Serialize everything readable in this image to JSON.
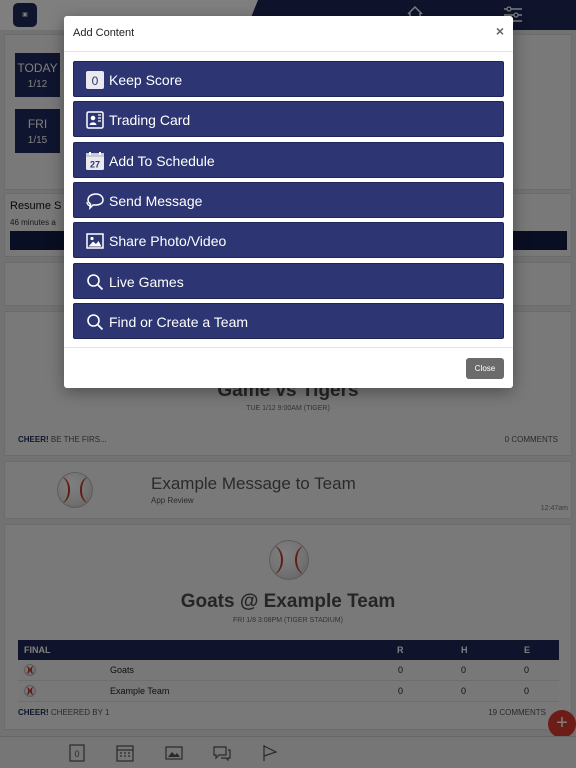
{
  "background": {
    "dates": [
      {
        "day": "TODAY",
        "date": "1/12"
      },
      {
        "day": "FRI",
        "date": "1/15"
      }
    ],
    "resume": {
      "title": "Resume S",
      "subtitle": "46 minutes a"
    },
    "game1": {
      "title": "Game vs Tigers",
      "subtitle": "TUE 1/12 9:00AM (TIGER)",
      "cheer_label": "CHEER!",
      "cheer_text": "BE THE FIRS...",
      "comments": "0 COMMENTS"
    },
    "message": {
      "title": "Example Message to Team",
      "subtitle": "App Review",
      "time": "12:47am"
    },
    "game2": {
      "title": "Goats @ Example Team",
      "subtitle": "FRI 1/8 3:08PM (TIGER STADIUM)",
      "cheer_label": "CHEER!",
      "cheer_text": "CHEERED BY 1",
      "comments": "19 COMMENTS",
      "table": {
        "headers": [
          "FINAL",
          "R",
          "H",
          "E"
        ],
        "rows": [
          {
            "team": "Goats",
            "r": "0",
            "h": "0",
            "e": "0"
          },
          {
            "team": "Example Team",
            "r": "0",
            "h": "0",
            "e": "0"
          }
        ]
      }
    },
    "fab_label": "+",
    "bottom_nav": {
      "score_icon_text": "0"
    }
  },
  "modal": {
    "title": "Add Content",
    "close_x": "×",
    "options": [
      {
        "label": "Keep Score",
        "icon": "score-icon",
        "icon_text": "0"
      },
      {
        "label": "Trading Card",
        "icon": "trading-card-icon"
      },
      {
        "label": "Add To Schedule",
        "icon": "calendar-icon",
        "icon_text": "27"
      },
      {
        "label": "Send Message",
        "icon": "message-icon"
      },
      {
        "label": "Share Photo/Video",
        "icon": "photo-icon"
      },
      {
        "label": "Live Games",
        "icon": "search-icon"
      },
      {
        "label": "Find or Create a Team",
        "icon": "search-icon"
      }
    ],
    "close_button": "Close"
  },
  "colors": {
    "accent": "#2d3672",
    "nav": "#1e2758",
    "fab": "#d93b2f"
  }
}
